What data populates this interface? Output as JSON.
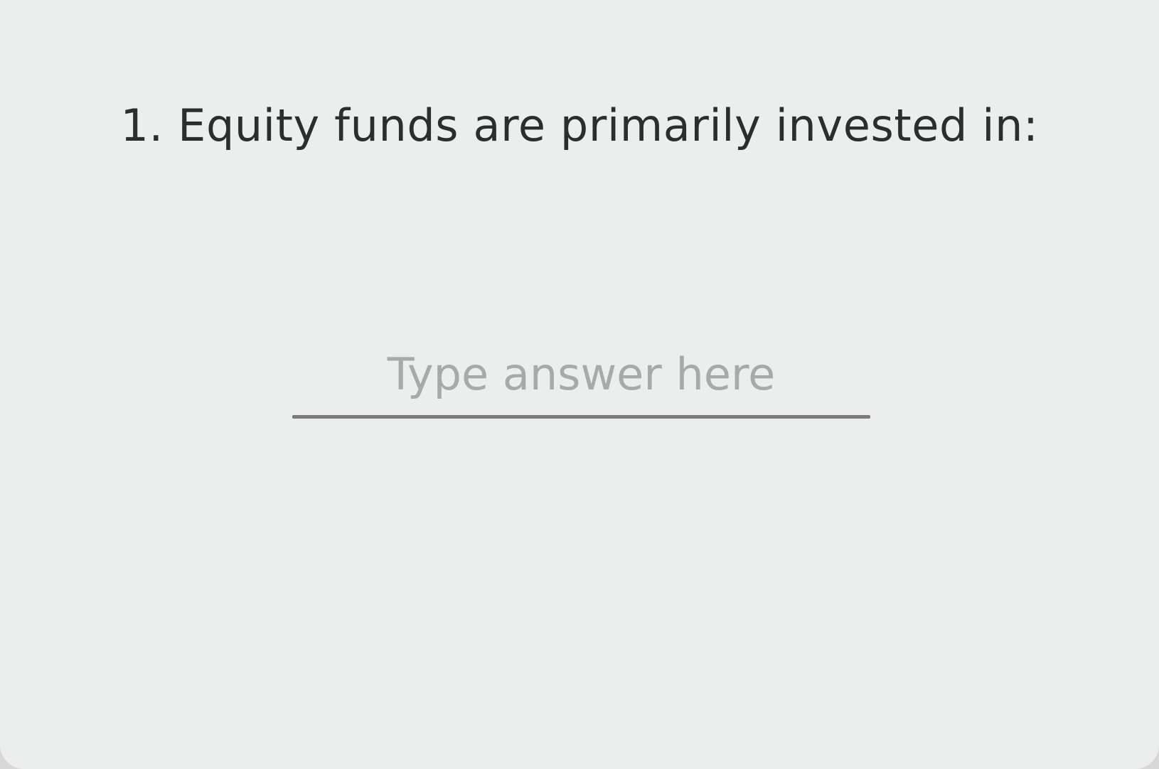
{
  "question": {
    "text": "1. Equity funds are primarily invested in:"
  },
  "answer": {
    "value": "",
    "placeholder": "Type answer here"
  }
}
